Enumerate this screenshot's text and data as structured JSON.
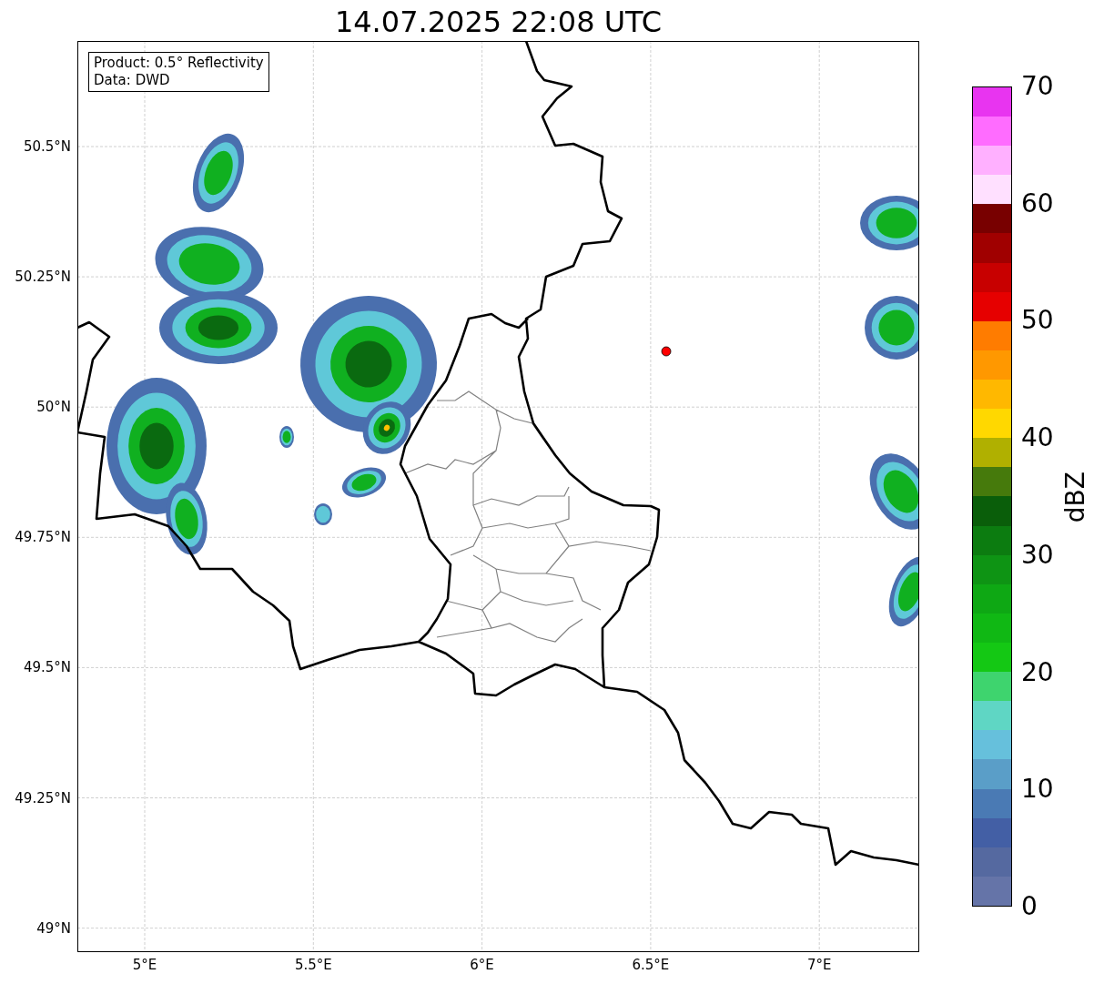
{
  "title": "14.07.2025 22:08 UTC",
  "info_box": [
    "Product: 0.5° Reflectivity",
    "Data: DWD"
  ],
  "y_ticks": [
    "50.5°N",
    "50.25°N",
    "50°N",
    "49.75°N",
    "49.5°N",
    "49.25°N",
    "49°N"
  ],
  "x_ticks": [
    "5°E",
    "5.5°E",
    "6°E",
    "6.5°E",
    "7°E"
  ],
  "colorbar": {
    "label": "dBZ",
    "ticks": [
      "70",
      "60",
      "50",
      "40",
      "30",
      "20",
      "10",
      "0"
    ],
    "bins": [
      {
        "color": "#6574a8"
      },
      {
        "color": "#5569a0"
      },
      {
        "color": "#435fa5"
      },
      {
        "color": "#4a7ab4"
      },
      {
        "color": "#5a9ec8"
      },
      {
        "color": "#66c0dc"
      },
      {
        "color": "#5fd6c4"
      },
      {
        "color": "#3ed46e"
      },
      {
        "color": "#14c814"
      },
      {
        "color": "#10b814"
      },
      {
        "color": "#0ea814"
      },
      {
        "color": "#0e9414"
      },
      {
        "color": "#0c7c10"
      },
      {
        "color": "#0a5e0a"
      },
      {
        "color": "#467a0c"
      },
      {
        "color": "#b0b000"
      },
      {
        "color": "#ffd800"
      },
      {
        "color": "#ffb800"
      },
      {
        "color": "#ff9800"
      },
      {
        "color": "#ff7c00"
      },
      {
        "color": "#e60000"
      },
      {
        "color": "#c80000"
      },
      {
        "color": "#a00000"
      },
      {
        "color": "#780000"
      },
      {
        "color": "#ffe0ff"
      },
      {
        "color": "#ffb0ff"
      },
      {
        "color": "#ff6cff"
      },
      {
        "color": "#e834f0"
      }
    ]
  }
}
